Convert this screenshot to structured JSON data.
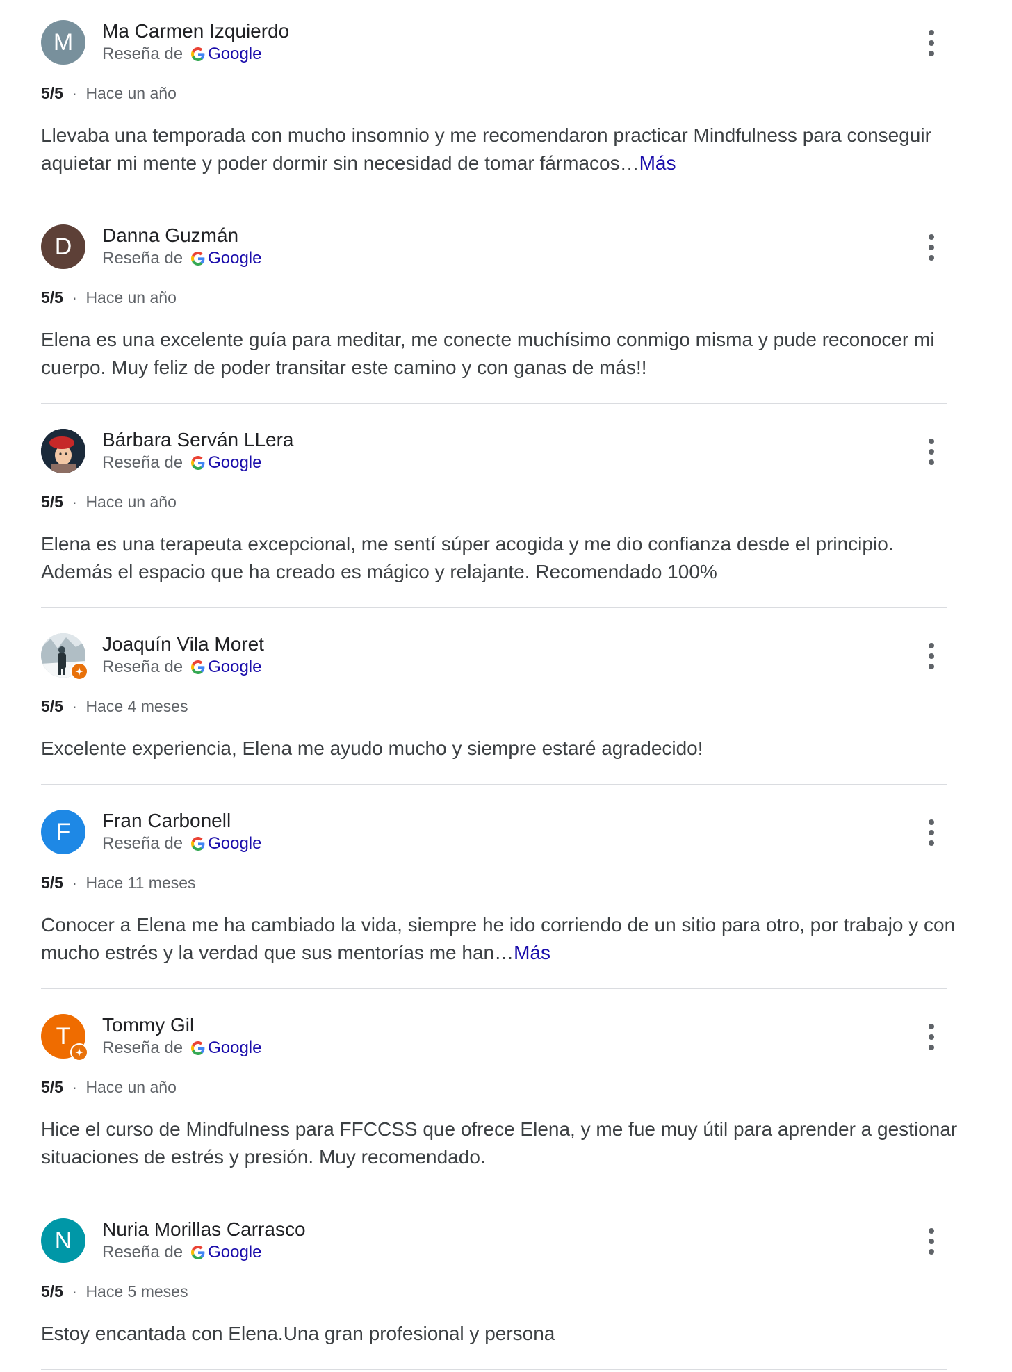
{
  "reviews": [
    {
      "name": "Ma Carmen Izquierdo",
      "avatar_letter": "M",
      "avatar_color": "#78909c",
      "avatar_type": "letter",
      "badge": false,
      "source_label": "Reseña de",
      "source_name": "Google",
      "score": "5/5",
      "separator": "·",
      "time": "Hace un año",
      "text": "Llevaba una temporada con mucho insomnio y me recomendaron practicar Mindfulness para conseguir aquietar mi mente y poder dormir sin necesidad de tomar fármacos…",
      "more": "Más"
    },
    {
      "name": "Danna Guzmán",
      "avatar_letter": "D",
      "avatar_color": "#5d4037",
      "avatar_type": "letter",
      "badge": false,
      "source_label": "Reseña de",
      "source_name": "Google",
      "score": "5/5",
      "separator": "·",
      "time": "Hace un año",
      "text": "Elena es una excelente guía para meditar, me conecte muchísimo conmigo misma y pude reconocer mi cuerpo. Muy feliz de poder transitar este camino y con ganas de más!!",
      "more": ""
    },
    {
      "name": "Bárbara Serván LLera",
      "avatar_letter": "",
      "avatar_color": "#1b2a3a",
      "avatar_type": "photo-woman-red-beret",
      "badge": false,
      "source_label": "Reseña de",
      "source_name": "Google",
      "score": "5/5",
      "separator": "·",
      "time": "Hace un año",
      "text": "Elena es una terapeuta excepcional, me sentí súper acogida y me dio confianza desde el principio. Además el espacio que ha creado es mágico y relajante. Recomendado 100%",
      "more": ""
    },
    {
      "name": "Joaquín Vila Moret",
      "avatar_letter": "",
      "avatar_color": "#cfd8dc",
      "avatar_type": "photo-man-snow",
      "badge": true,
      "source_label": "Reseña de",
      "source_name": "Google",
      "score": "5/5",
      "separator": "·",
      "time": "Hace 4 meses",
      "text": "Excelente experiencia, Elena me ayudo mucho y siempre estaré agradecido!",
      "more": ""
    },
    {
      "name": "Fran Carbonell",
      "avatar_letter": "F",
      "avatar_color": "#1e88e5",
      "avatar_type": "letter",
      "badge": false,
      "source_label": "Reseña de",
      "source_name": "Google",
      "score": "5/5",
      "separator": "·",
      "time": "Hace 11 meses",
      "text": "Conocer a Elena me ha cambiado la vida, siempre he ido corriendo de un sitio para otro, por trabajo y con mucho estrés y la verdad que sus mentorías me han…",
      "more": "Más"
    },
    {
      "name": "Tommy Gil",
      "avatar_letter": "T",
      "avatar_color": "#ef6c00",
      "avatar_type": "letter",
      "badge": true,
      "source_label": "Reseña de",
      "source_name": "Google",
      "score": "5/5",
      "separator": "·",
      "time": "Hace un año",
      "text": "Hice el curso de Mindfulness para FFCCSS que ofrece Elena, y me fue muy útil para aprender a gestionar situaciones de estrés y presión. Muy recomendado.",
      "more": ""
    },
    {
      "name": "Nuria Morillas Carrasco",
      "avatar_letter": "N",
      "avatar_color": "#0097a7",
      "avatar_type": "letter",
      "badge": false,
      "source_label": "Reseña de",
      "source_name": "Google",
      "score": "5/5",
      "separator": "·",
      "time": "Hace 5 meses",
      "text": "Estoy encantada con Elena.Una gran profesional y persona",
      "more": ""
    }
  ]
}
